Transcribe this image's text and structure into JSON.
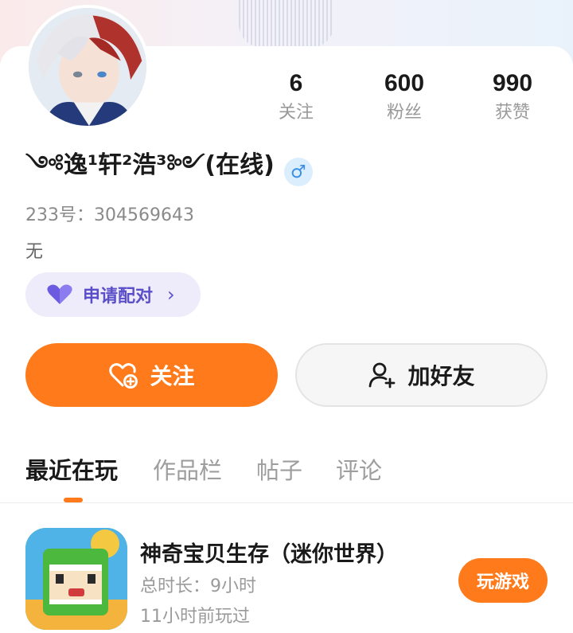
{
  "stats": [
    {
      "num": "6",
      "label": "关注"
    },
    {
      "num": "600",
      "label": "粉丝"
    },
    {
      "num": "990",
      "label": "获赞"
    }
  ],
  "profile": {
    "name": "༺逸¹轩²浩³༻(在线)",
    "gender_symbol": "♂",
    "uid": "233号：304569643",
    "bio": "无"
  },
  "pair_button": {
    "label": "申请配对",
    "chevron": "›",
    "icon": "heart-icon"
  },
  "actions": {
    "follow": "关注",
    "add_friend": "加好友"
  },
  "tabs": [
    {
      "label": "最近在玩",
      "active": true
    },
    {
      "label": "作品栏",
      "active": false
    },
    {
      "label": "帖子",
      "active": false
    },
    {
      "label": "评论",
      "active": false
    }
  ],
  "game": {
    "title": "神奇宝贝生存（迷你世界）",
    "duration": "总时长：9小时",
    "last_played": "11小时前玩过",
    "play_label": "玩游戏"
  },
  "colors": {
    "accent": "#ff7a1a",
    "pair": "#5a4fc8",
    "gender": "#3b8fe6"
  }
}
